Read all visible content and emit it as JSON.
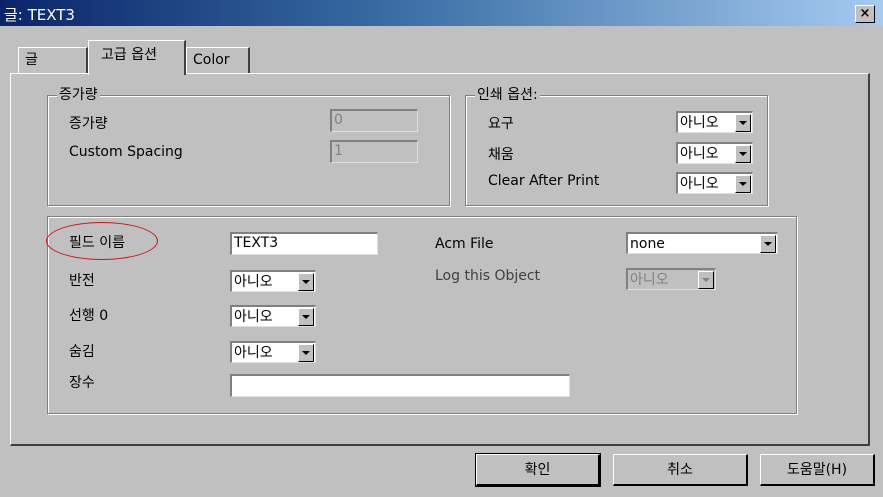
{
  "window": {
    "title": "글: TEXT3",
    "close_glyph": "×"
  },
  "tabs": [
    {
      "label": "글",
      "active": false
    },
    {
      "label": "고급 옵션",
      "active": true
    },
    {
      "label": "Color",
      "active": false
    }
  ],
  "increment_group": {
    "legend": "증가량",
    "increment_label": "증가량",
    "increment_value": "0",
    "spacing_label": "Custom Spacing",
    "spacing_value": "1"
  },
  "print_group": {
    "legend": "인쇄 옵션:",
    "required_label": "요구",
    "required_value": "아니오",
    "fill_label": "채움",
    "fill_value": "아니오",
    "clear_label": "Clear After Print",
    "clear_value": "아니오"
  },
  "field_group": {
    "field_name_label": "필드 이름",
    "field_name_value": "TEXT3",
    "reverse_label": "반전",
    "reverse_value": "아니오",
    "leading_zero_label": "선행 0",
    "leading_zero_value": "아니오",
    "hidden_label": "숨김",
    "hidden_value": "아니오",
    "copies_label": "장수",
    "copies_value": "",
    "acm_label": "Acm File",
    "acm_value": "none",
    "log_label": "Log this Object",
    "log_value": "아니오"
  },
  "buttons": {
    "ok": "확인",
    "cancel": "취소",
    "help": "도움말(H)"
  },
  "colors": {
    "annotation": "#d01010",
    "titlebar_start": "#0a246a"
  }
}
